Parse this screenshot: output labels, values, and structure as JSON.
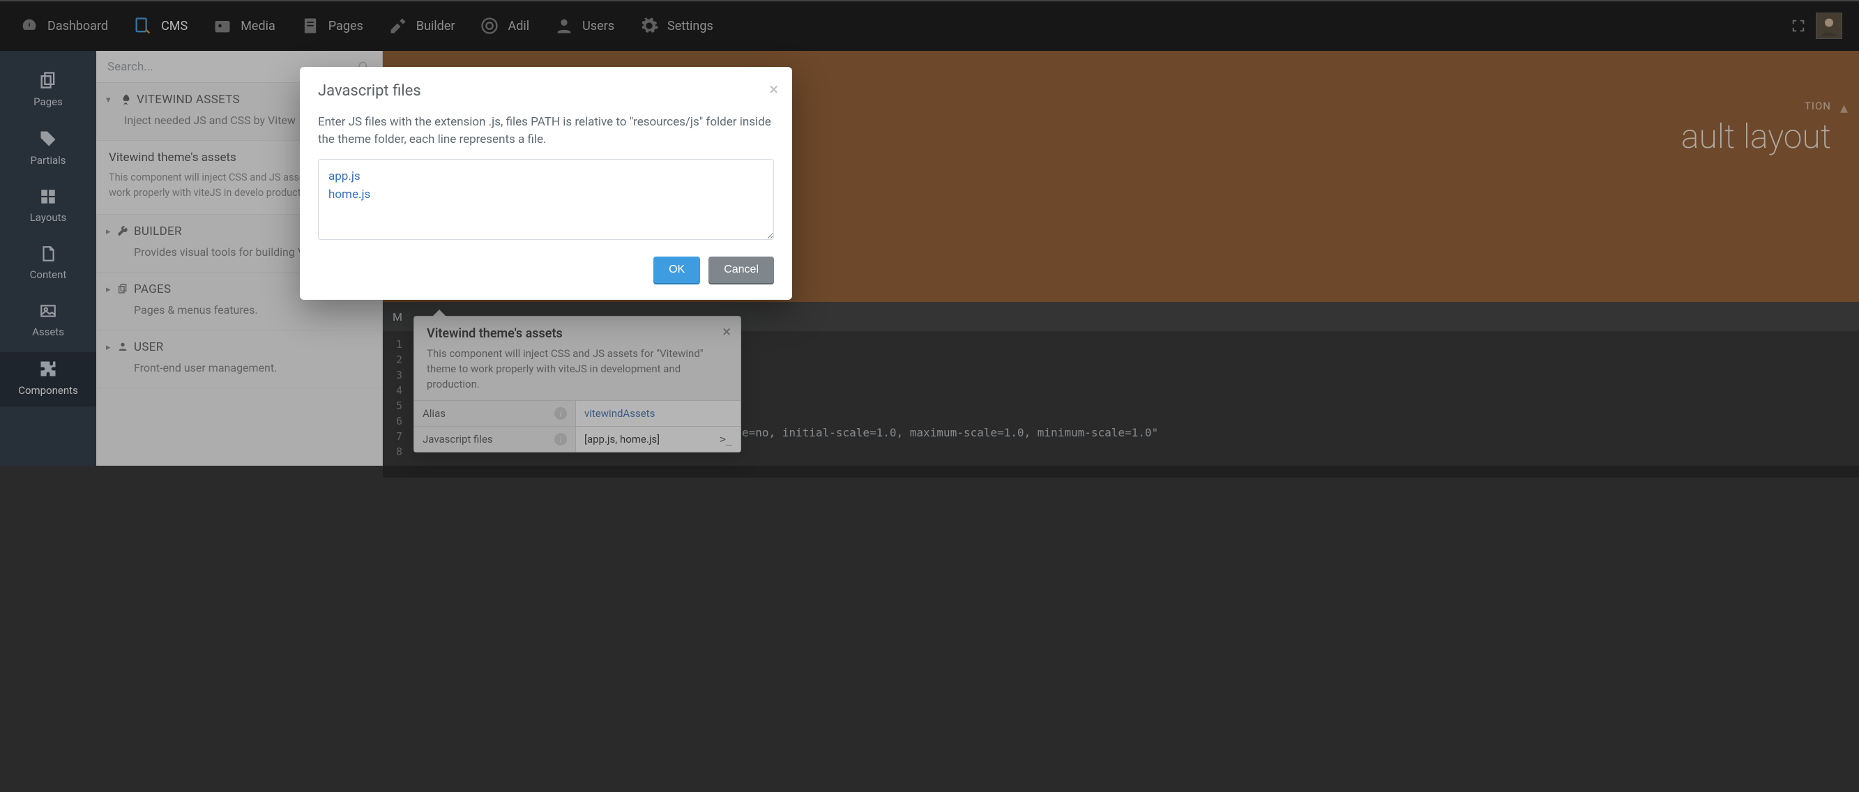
{
  "topnav": {
    "items": [
      {
        "label": "Dashboard",
        "icon": "gauge-icon"
      },
      {
        "label": "CMS",
        "icon": "cms-icon",
        "active": true
      },
      {
        "label": "Media",
        "icon": "media-icon"
      },
      {
        "label": "Pages",
        "icon": "pages-icon"
      },
      {
        "label": "Builder",
        "icon": "builder-icon"
      },
      {
        "label": "Adil",
        "icon": "life-ring-icon"
      },
      {
        "label": "Users",
        "icon": "user-icon"
      },
      {
        "label": "Settings",
        "icon": "gear-icon"
      }
    ]
  },
  "rail": {
    "items": [
      {
        "label": "Pages",
        "icon": "copy-icon"
      },
      {
        "label": "Partials",
        "icon": "tags-icon"
      },
      {
        "label": "Layouts",
        "icon": "grid-icon"
      },
      {
        "label": "Content",
        "icon": "file-icon"
      },
      {
        "label": "Assets",
        "icon": "image-icon"
      },
      {
        "label": "Components",
        "icon": "puzzle-icon",
        "active": true
      }
    ]
  },
  "browser": {
    "search_placeholder": "Search...",
    "groups": [
      {
        "title": "VITEWIND ASSETS",
        "icon": "rocket-icon",
        "desc": "Inject needed JS and CSS by Vitew",
        "expanded": true,
        "selected": {
          "title": "Vitewind theme's assets",
          "desc": "This component will inject CSS and JS assets theme to work properly with viteJS in develo production."
        }
      },
      {
        "title": "BUILDER",
        "icon": "wrench-icon",
        "desc": "Provides visual tools for building V plugins."
      },
      {
        "title": "PAGES",
        "icon": "copy-icon",
        "desc": "Pages & menus features."
      },
      {
        "title": "USER",
        "icon": "user-icon",
        "desc": "Front-end user management."
      }
    ]
  },
  "editor": {
    "breadcrumb": "TION",
    "title": "ault layout",
    "codebar": "M",
    "gutter": [
      "1",
      "2",
      "3",
      "4",
      "5",
      "6",
      "7",
      "8"
    ],
    "code_line": "content=\"width=device-width, user-scalable=no, initial-scale=1.0, maximum-scale=1.0, minimum-scale=1.0\""
  },
  "inspector": {
    "title": "Vitewind theme's assets",
    "desc": "This component will inject CSS and JS assets for \"Vitewind\" theme to work properly with viteJS in development and production.",
    "rows": [
      {
        "label": "Alias",
        "value": "vitewindAssets",
        "link": true
      },
      {
        "label": "Javascript files",
        "value": "[app.js, home.js]",
        "term": true
      }
    ]
  },
  "modal": {
    "title": "Javascript files",
    "desc": "Enter JS files with the extension .js, files PATH is relative to \"resources/js\" folder inside the theme folder, each line represents a file.",
    "textarea_value": "app.js\nhome.js",
    "ok": "OK",
    "cancel": "Cancel"
  }
}
